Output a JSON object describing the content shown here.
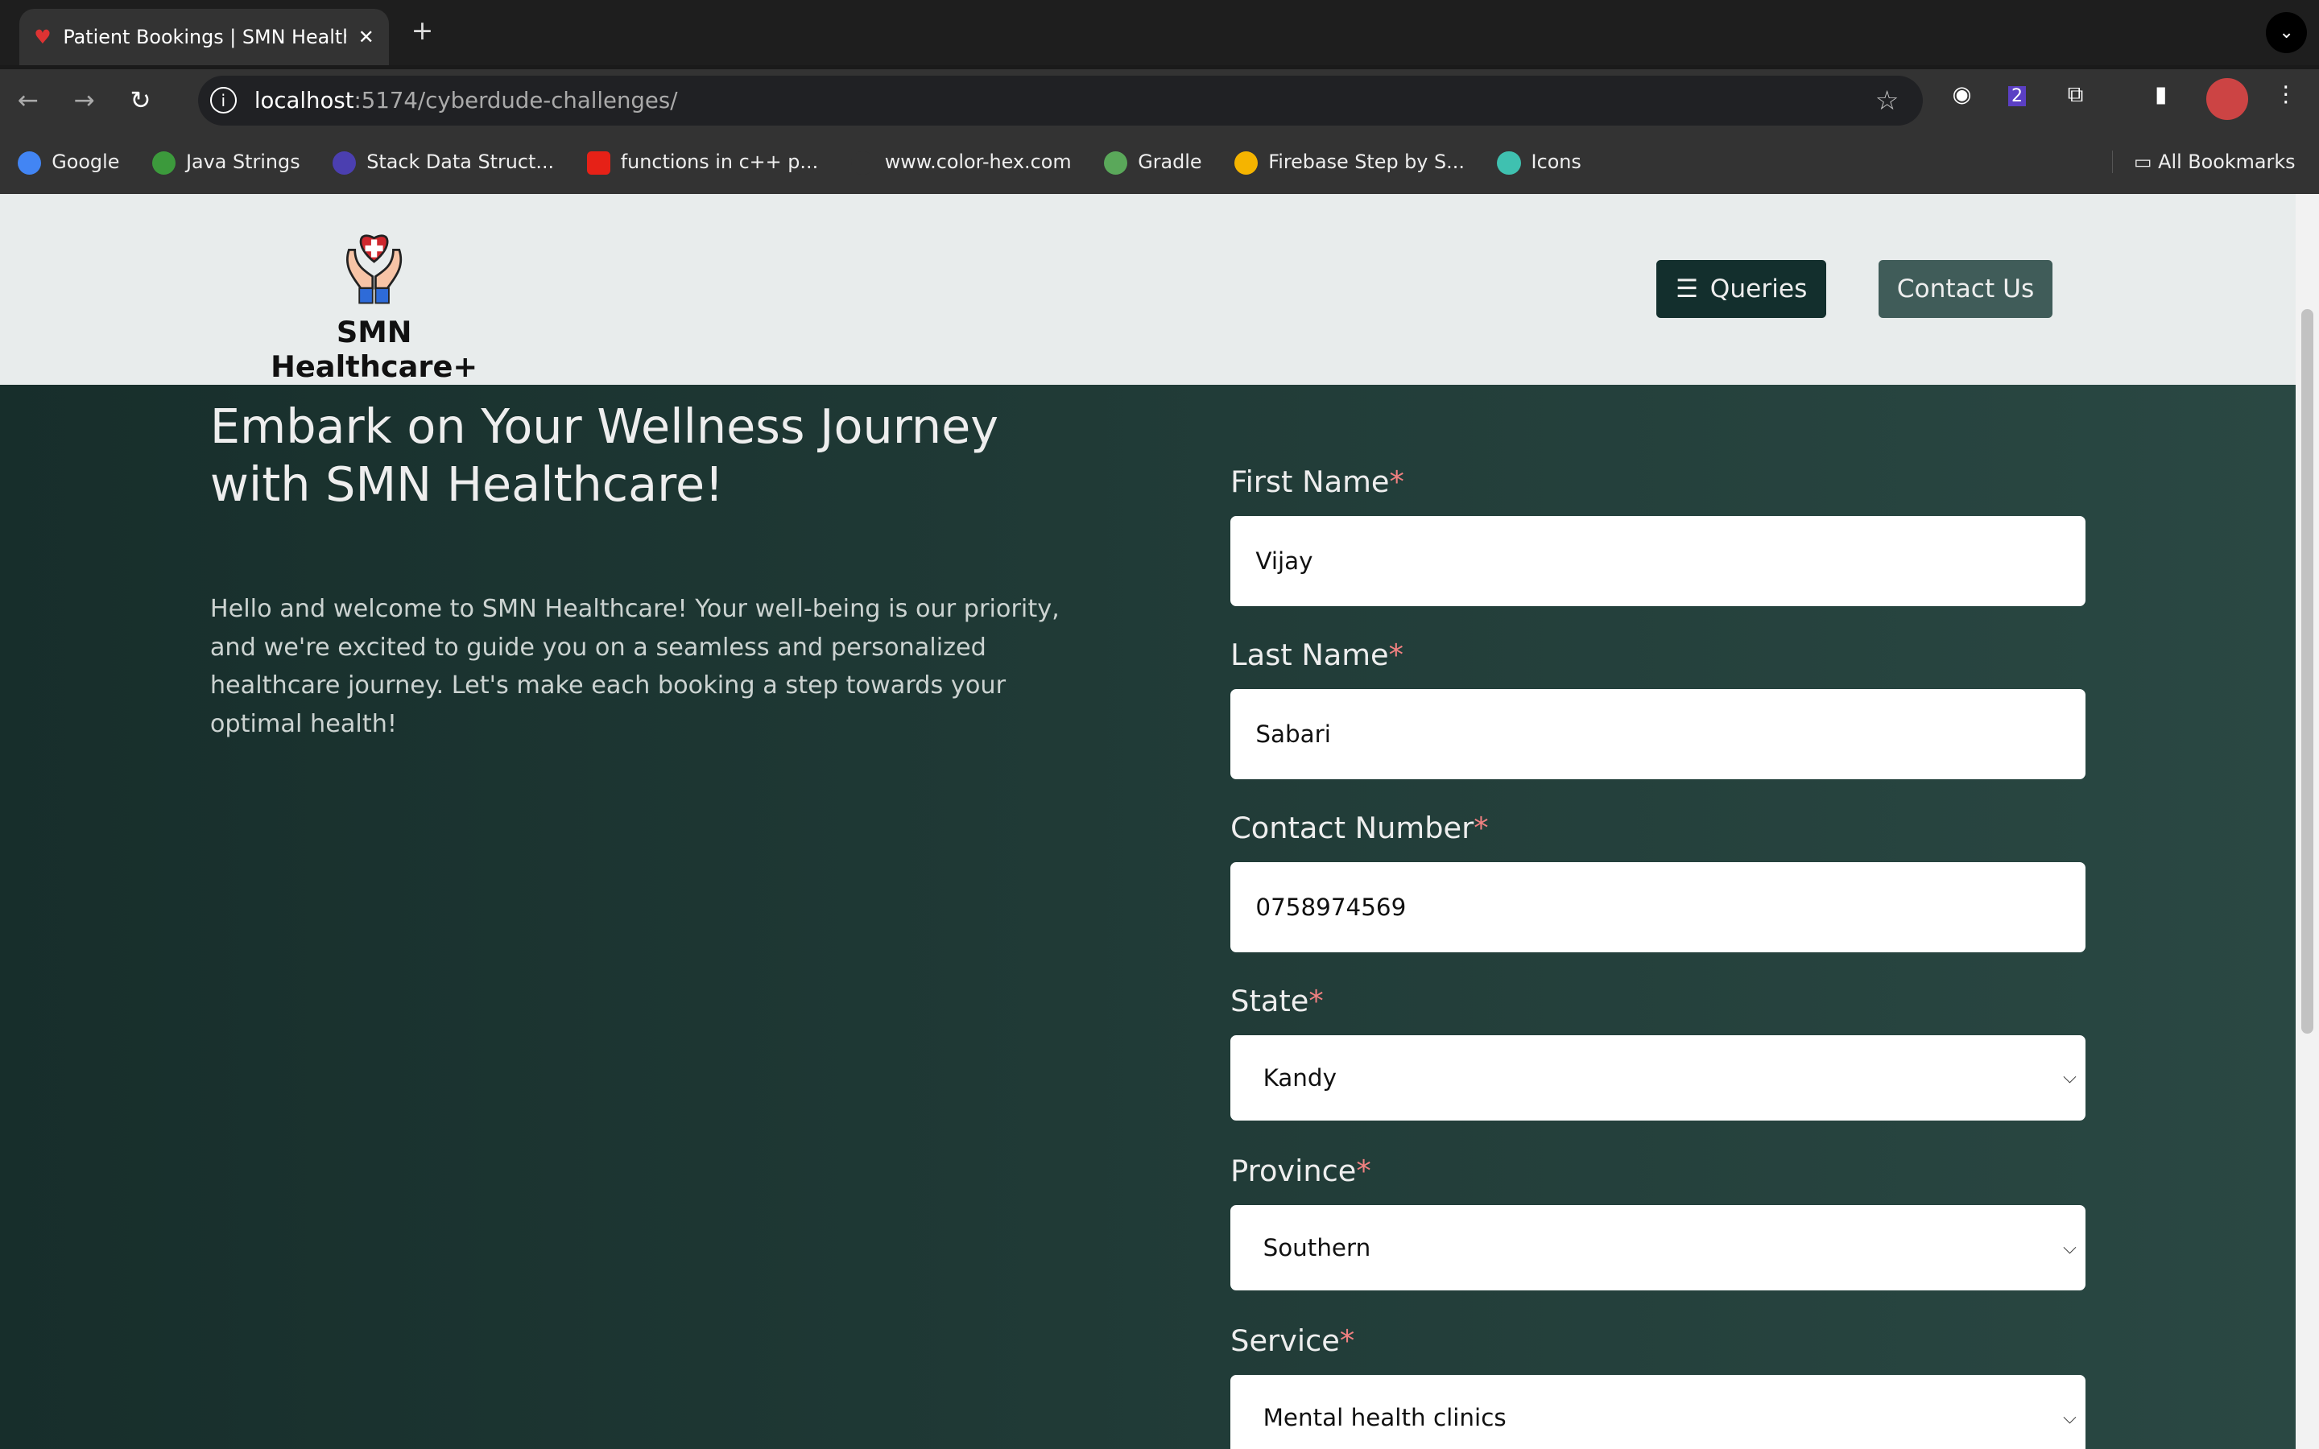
{
  "browser": {
    "tab_title": "Patient Bookings | SMN Healthcare+",
    "url_host": "localhost",
    "url_path": ":5174/cyberdude-challenges/",
    "bookmarks": [
      {
        "label": "Google",
        "color": "#4285f4"
      },
      {
        "label": "Java Strings",
        "color": "#3c9a3c"
      },
      {
        "label": "Stack Data Struct...",
        "color": "#4b3fb0"
      },
      {
        "label": "functions in c++ p...",
        "color": "#e62117"
      },
      {
        "label": "www.color-hex.com",
        "color": "#333333"
      },
      {
        "label": "Gradle",
        "color": "#5aa85a"
      },
      {
        "label": "Firebase Step by S...",
        "color": "#f5b400"
      },
      {
        "label": "Icons",
        "color": "#3fc1b0"
      }
    ],
    "all_bookmarks": "All Bookmarks"
  },
  "header": {
    "brand": "SMN Healthcare+",
    "queries": "Queries",
    "contact": "Contact Us"
  },
  "hero": {
    "title": "Embark on Your Wellness Journey with SMN Healthcare!",
    "text": "Hello and welcome to SMN Healthcare! Your well-being is our priority, and we're excited to guide you on a seamless and personalized healthcare journey. Let's make each booking a step towards your optimal health!"
  },
  "form": {
    "required": "*",
    "first_name": {
      "label": "First Name",
      "value": "Vijay"
    },
    "last_name": {
      "label": "Last Name",
      "value": "Sabari"
    },
    "contact": {
      "label": "Contact Number",
      "value": "0758974569"
    },
    "state": {
      "label": "State",
      "value": "Kandy"
    },
    "province": {
      "label": "Province",
      "value": "Southern"
    },
    "service": {
      "label": "Service",
      "value": "Mental health clinics"
    }
  }
}
